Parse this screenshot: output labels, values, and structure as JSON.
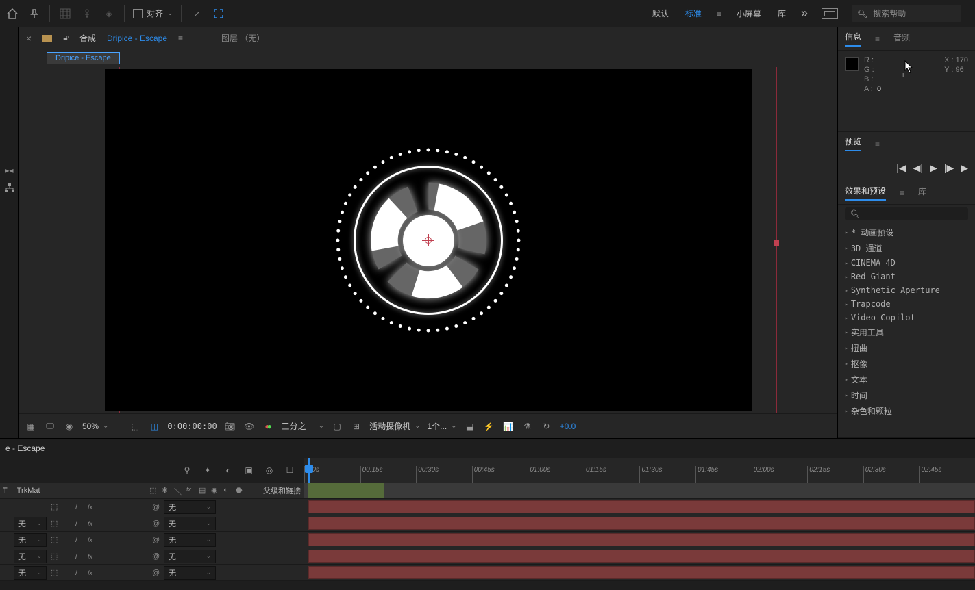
{
  "toolbar": {
    "align_label": "对齐",
    "workspaces": [
      "默认",
      "标准",
      "小屏幕",
      "库"
    ],
    "active_ws": 1,
    "search_placeholder": "搜索帮助"
  },
  "viewer": {
    "tab_prefix": "合成",
    "comp_name": "Dripice - Escape",
    "layer_label": "图层 （无）",
    "subtab": "Dripice - Escape"
  },
  "footer": {
    "zoom": "50%",
    "timecode": "0:00:00:00",
    "resolution": "三分之一",
    "camera": "活动摄像机",
    "views": "1个...",
    "offset": "+0.0"
  },
  "info_panel": {
    "tabs": [
      "信息",
      "音频"
    ],
    "R": "R :",
    "G": "G :",
    "B": "B :",
    "A_label": "A :",
    "A_val": "0",
    "X": "X : 170",
    "Y": "Y : 96"
  },
  "preview_panel": {
    "title": "预览"
  },
  "effects_panel": {
    "tabs": [
      "效果和预设",
      "库"
    ],
    "items": [
      "* 动画预设",
      "3D 通道",
      "CINEMA 4D",
      "Red Giant",
      "Synthetic Aperture",
      "Trapcode",
      "Video Copilot",
      "实用工具",
      "扭曲",
      "抠像",
      "文本",
      "时间",
      "杂色和颗粒"
    ]
  },
  "timeline": {
    "tab": "e - Escape",
    "col_t": "T",
    "col_trkmat": "TrkMat",
    "col_parent": "父级和链接",
    "ticks": [
      ":00s",
      "00:15s",
      "00:30s",
      "00:45s",
      "01:00s",
      "01:15s",
      "01:30s",
      "01:45s",
      "02:00s",
      "02:15s",
      "02:30s",
      "02:45s"
    ],
    "none": "无",
    "layers": [
      {
        "has_trkmat": false
      },
      {
        "has_trkmat": true
      },
      {
        "has_trkmat": true
      },
      {
        "has_trkmat": true
      },
      {
        "has_trkmat": true
      }
    ]
  }
}
